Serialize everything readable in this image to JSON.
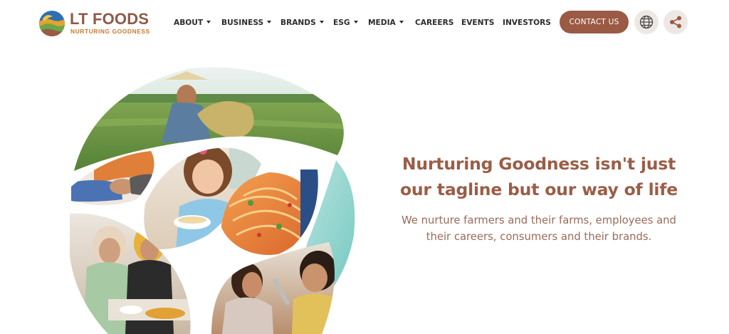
{
  "brand": {
    "name": "LT FOODS",
    "tagline": "NURTURING GOODNESS",
    "logo_icon": "lt-foods-logo-mark",
    "colors": {
      "primary_brown": "#9a5a44",
      "orange": "#c47a2a",
      "green": "#6aa64a",
      "blue": "#2d6fb5"
    }
  },
  "nav": {
    "items": [
      {
        "label": "ABOUT",
        "dropdown": true
      },
      {
        "label": "BUSINESS",
        "dropdown": true
      },
      {
        "label": "BRANDS",
        "dropdown": true
      },
      {
        "label": "ESG",
        "dropdown": true
      },
      {
        "label": "MEDIA",
        "dropdown": true
      },
      {
        "label": "CAREERS",
        "dropdown": false
      },
      {
        "label": "EVENTS",
        "dropdown": false
      },
      {
        "label": "INVESTORS",
        "dropdown": false
      }
    ],
    "contact_label": "CONTACT US",
    "globe_icon": "globe-icon",
    "share_icon": "share-icon"
  },
  "hero": {
    "headline": "Nurturing Goodness isn't just our tagline but our way of life",
    "subtext": "We nurture farmers and their farms, employees and their careers, consumers and their brands."
  }
}
